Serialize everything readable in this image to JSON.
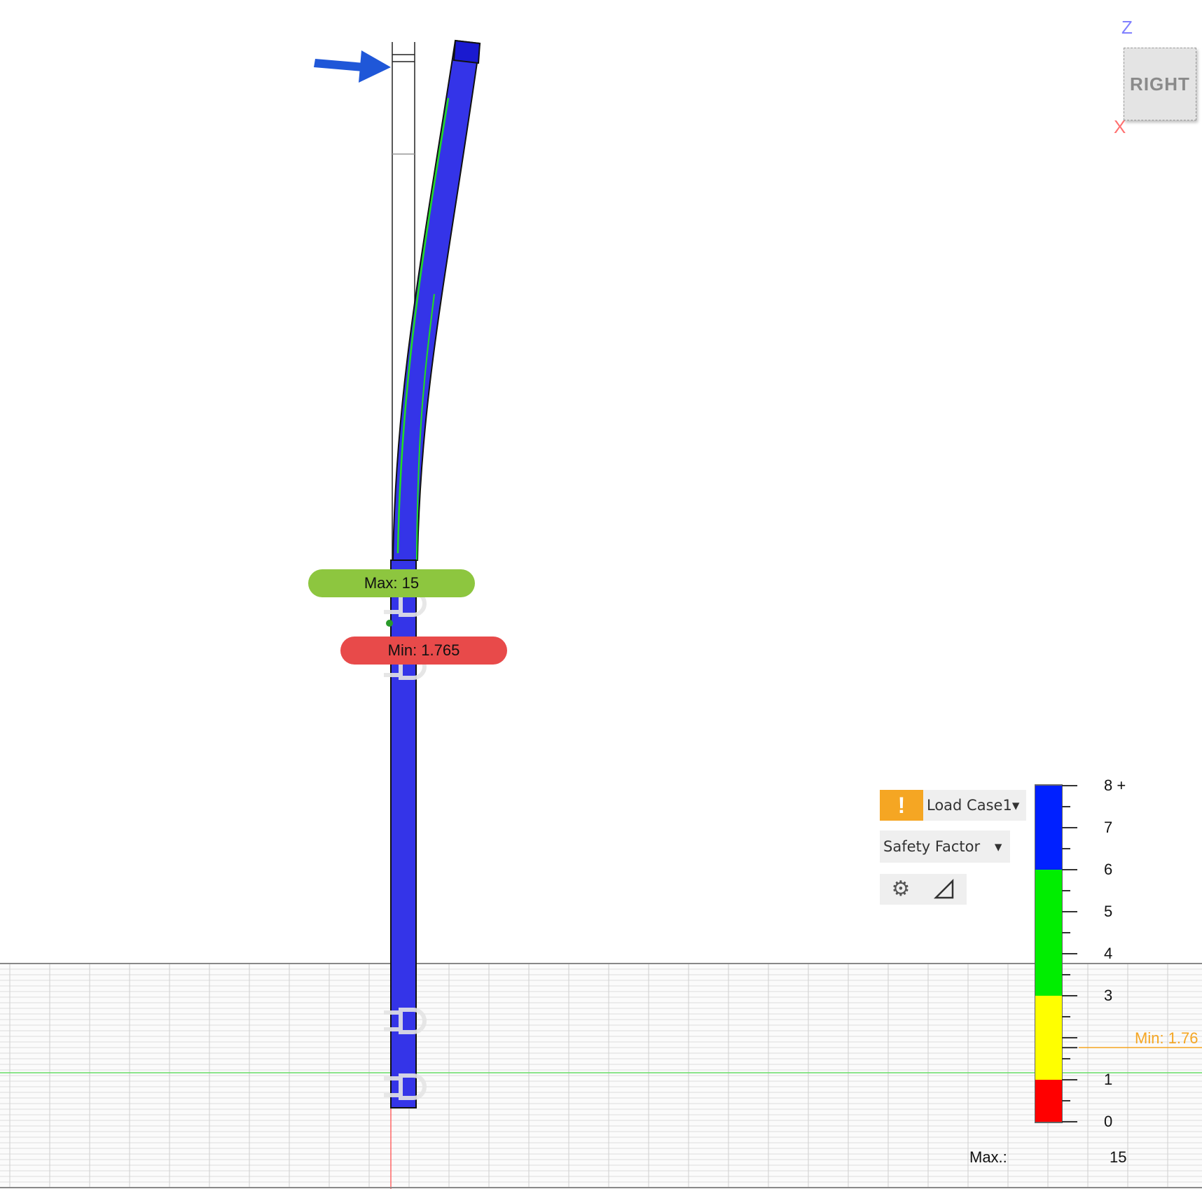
{
  "probes": {
    "max": "Max: 15",
    "min": "Min: 1.765"
  },
  "viewcube": {
    "face": "RIGHT",
    "axis_z": "Z",
    "axis_x": "X"
  },
  "results_panel": {
    "warning_symbol": "!",
    "load_case": "Load Case1",
    "load_case_arrow": "▾",
    "result_type": "Safety Factor",
    "result_type_arrow": "▾",
    "settings_icon": "gear-icon",
    "triangle_icon": "triangle-icon"
  },
  "legend": {
    "ticks": [
      "8 +",
      "7",
      "6",
      "5",
      "4",
      "3",
      "1",
      "0"
    ],
    "min_marker": "Min: 1.76",
    "max_label": "Max.:",
    "max_value": "15",
    "bands": [
      {
        "from": 6,
        "to": 8,
        "color": "#0020ff"
      },
      {
        "from": 3,
        "to": 6,
        "color": "#00ee00"
      },
      {
        "from": 1,
        "to": 3,
        "color": "#ffff00"
      },
      {
        "from": 0,
        "to": 1,
        "color": "#ff0000"
      }
    ],
    "min_value": 1.765
  },
  "colors": {
    "beam": "#3333e6",
    "ground_grid": "#d8d8d8",
    "load_arrow": "#1f57d8"
  }
}
